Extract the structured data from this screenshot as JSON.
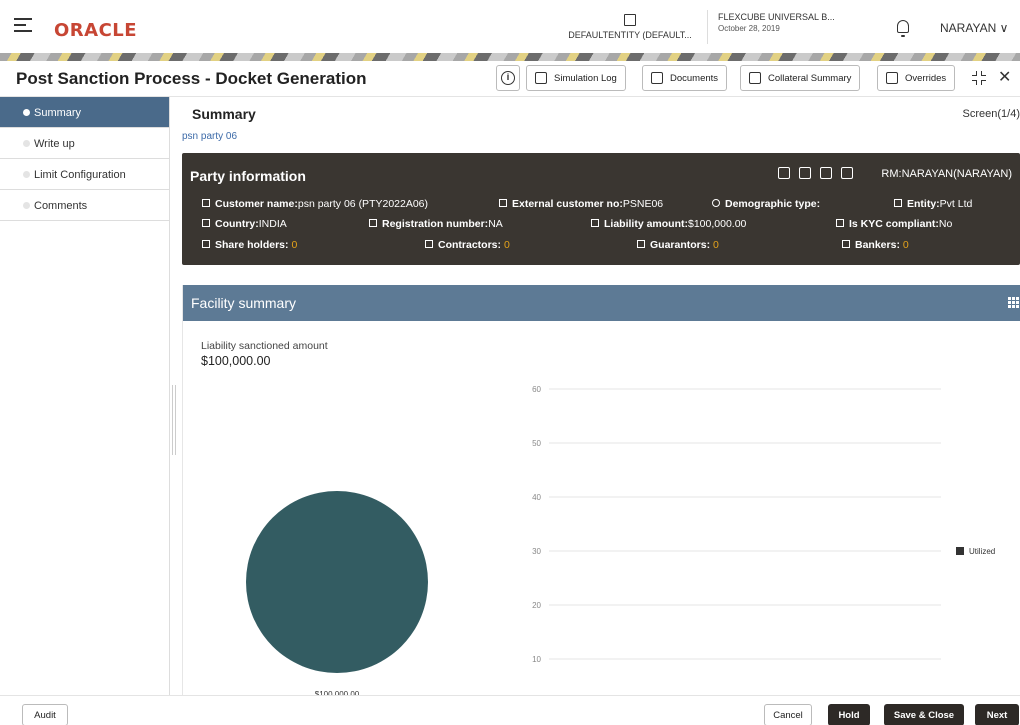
{
  "header": {
    "logo": "ORACLE",
    "entity_label": "DEFAULTENTITY (DEFAULT...",
    "app_name": "FLEXCUBE UNIVERSAL B...",
    "app_date": "October 28, 2019",
    "user": "NARAYAN ∨"
  },
  "titlebar": {
    "title": "Post Sanction Process - Docket Generation",
    "info_label": "i",
    "buttons": {
      "simulation_log": "Simulation Log",
      "documents": "Documents",
      "collateral_summary": "Collateral Summary",
      "overrides": "Overrides"
    },
    "close": "✕"
  },
  "nav": {
    "items": [
      {
        "label": "Summary"
      },
      {
        "label": "Write up"
      },
      {
        "label": "Limit Configuration"
      },
      {
        "label": "Comments"
      }
    ]
  },
  "summary": {
    "title": "Summary",
    "screen": "Screen(1/4)",
    "party_link": "psn party 06"
  },
  "party": {
    "title": "Party information",
    "rm": "RM:NARAYAN(NARAYAN)",
    "customer_name_label": "Customer name:",
    "customer_name": "psn party 06 (PTY2022A06)",
    "external_no_label": "External customer no:",
    "external_no": "PSNE06",
    "demographic_label": "Demographic type:",
    "demographic": "",
    "entity_label": "Entity:",
    "entity": "Pvt Ltd",
    "country_label": "Country:",
    "country": "INDIA",
    "registration_label": "Registration number:",
    "registration": "NA",
    "liability_label": "Liability amount:",
    "liability": "$100,000.00",
    "kyc_label": "Is KYC compliant:",
    "kyc": "No",
    "shareholders_label": "Share holders:",
    "shareholders": "0",
    "contractors_label": "Contractors:",
    "contractors": "0",
    "guarantors_label": "Guarantors:",
    "guarantors": "0",
    "bankers_label": "Bankers:",
    "bankers": "0"
  },
  "facility": {
    "title": "Facility summary",
    "liability_label": "Liability sanctioned amount",
    "liability_value": "$100,000.00"
  },
  "chart_data": [
    {
      "type": "pie",
      "values": [
        100000
      ],
      "data_labels": [
        "$100,000.00"
      ],
      "colors": [
        "#335c62"
      ]
    },
    {
      "type": "bar",
      "categories": [],
      "series": [
        {
          "name": "Utilized",
          "values": []
        }
      ],
      "yticks": [
        "60",
        "50",
        "40",
        "30",
        "20",
        "10"
      ],
      "legend_position": "right",
      "legend_color": "#333333"
    }
  ],
  "footer": {
    "audit": "Audit",
    "cancel": "Cancel",
    "hold": "Hold",
    "save_close": "Save & Close",
    "next": "Next"
  }
}
